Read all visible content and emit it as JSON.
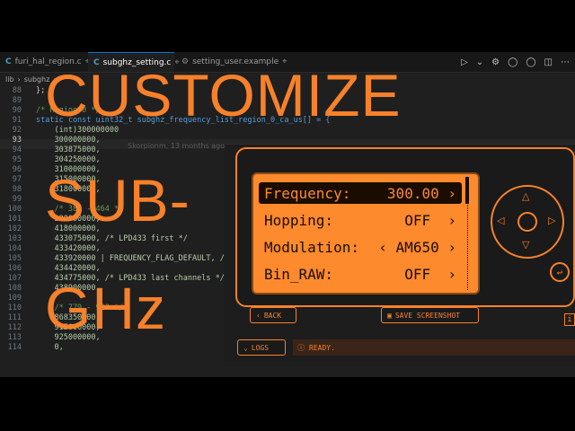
{
  "tabs": [
    {
      "icon": "C",
      "label": "furi_hal_region.c",
      "pin": "⌖"
    },
    {
      "icon": "C",
      "label": "subghz_setting.c",
      "pin": "⌖",
      "active": true
    },
    {
      "icon": "⚙",
      "label": "setting_user.example",
      "pin": "⌖"
    }
  ],
  "breadcrumb": [
    "lib",
    "›",
    "subghz",
    "›"
  ],
  "code_lines": [
    {
      "n": "88",
      "t": "};"
    },
    {
      "n": "89",
      "t": ""
    },
    {
      "n": "90",
      "t": "/* Region 0 */"
    },
    {
      "n": "91",
      "t": "static const uint32_t subghz_frequency_list_region_0_ca_us[] = {"
    },
    {
      "n": "92",
      "t": "    (int)300000000"
    },
    {
      "n": "93",
      "t": "    300000000,"
    },
    {
      "n": "94",
      "t": "    303875000,"
    },
    {
      "n": "95",
      "t": "    304250000,"
    },
    {
      "n": "96",
      "t": "    310000000,"
    },
    {
      "n": "97",
      "t": "    315000000,"
    },
    {
      "n": "98",
      "t": "    318000000,"
    },
    {
      "n": "99",
      "t": ""
    },
    {
      "n": "100",
      "t": "    /* 387 - 464 */"
    },
    {
      "n": "101",
      "t": "    390000000,"
    },
    {
      "n": "102",
      "t": "    418000000,"
    },
    {
      "n": "103",
      "t": "    433075000, /* LPD433 first */"
    },
    {
      "n": "104",
      "t": "    433420000,"
    },
    {
      "n": "105",
      "t": "    433920000 | FREQUENCY_FLAG_DEFAULT, /*"
    },
    {
      "n": "106",
      "t": "    434420000,"
    },
    {
      "n": "107",
      "t": "    434775000, /* LPD433 last channels */"
    },
    {
      "n": "108",
      "t": "    438900000,"
    },
    {
      "n": "109",
      "t": ""
    },
    {
      "n": "110",
      "t": "    /* 779 - 928 */"
    },
    {
      "n": "111",
      "t": "    868350000,"
    },
    {
      "n": "112",
      "t": "    915000000,"
    },
    {
      "n": "113",
      "t": "    925000000,"
    },
    {
      "n": "114",
      "t": "    0,"
    }
  ],
  "ghost_text": "Skorpionm, 13 months ago",
  "overlay": {
    "line1": "CUSTOMIZE",
    "line2": "SUB-",
    "line3": "GHz"
  },
  "flipper": {
    "menu": [
      {
        "label": "Frequency:",
        "value": "300.00",
        "prefix": "",
        "suffix": "›"
      },
      {
        "label": "Hopping:",
        "value": "OFF",
        "prefix": "",
        "suffix": "›"
      },
      {
        "label": "Modulation:",
        "value": "AM650",
        "prefix": "‹",
        "suffix": "›"
      },
      {
        "label": "Bin_RAW:",
        "value": "OFF",
        "prefix": "",
        "suffix": "›"
      }
    ],
    "back_label": "BACK",
    "save_label": "SAVE SCREENSHOT",
    "logs_label": "LOGS",
    "status_text": "READY."
  },
  "colors": {
    "accent": "#f7812a",
    "screen": "#fd8a2d",
    "ink": "#1a0d00"
  }
}
